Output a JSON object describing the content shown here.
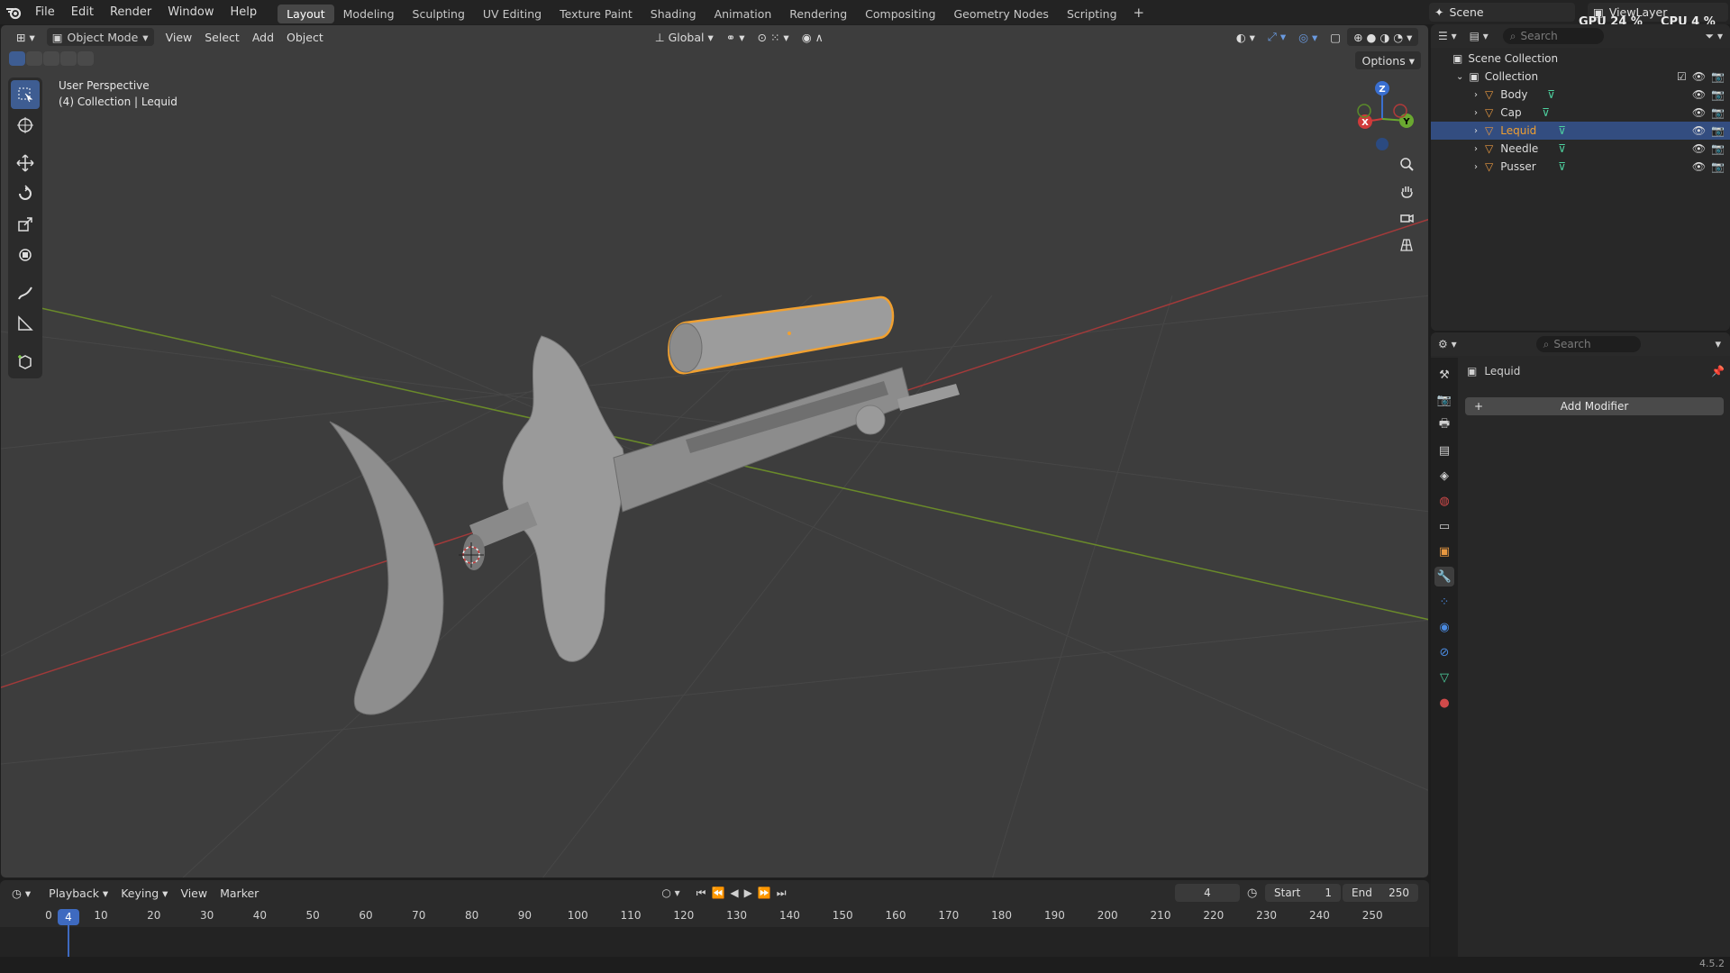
{
  "topbar": {
    "menus": [
      "File",
      "Edit",
      "Render",
      "Window",
      "Help"
    ],
    "workspaces": [
      "Layout",
      "Modeling",
      "Sculpting",
      "UV Editing",
      "Texture Paint",
      "Shading",
      "Animation",
      "Rendering",
      "Compositing",
      "Geometry Nodes",
      "Scripting"
    ],
    "active_workspace": "Layout",
    "add_label": "+",
    "scene": "Scene",
    "view_layer": "ViewLayer",
    "gpu_label": "GPU",
    "gpu_value": "24 %",
    "cpu_label": "CPU",
    "cpu_value": "4 %"
  },
  "viewport": {
    "mode": "Object Mode",
    "menus": [
      "View",
      "Select",
      "Add",
      "Object"
    ],
    "transform_orientation": "Global",
    "options_label": "Options",
    "info_line1": "User Perspective",
    "info_line2": "(4) Collection | Lequid",
    "gizmo": {
      "x": "X",
      "y": "Y",
      "z": "Z"
    }
  },
  "outliner": {
    "search_placeholder": "Search",
    "scene_collection": "Scene Collection",
    "collection": "Collection",
    "objects": [
      "Body",
      "Cap",
      "Lequid",
      "Needle",
      "Pusser"
    ],
    "selected_object": "Lequid"
  },
  "properties": {
    "search_placeholder": "Search",
    "object_name": "Lequid",
    "add_modifier": "Add Modifier"
  },
  "timeline": {
    "menus": [
      "Playback",
      "Keying",
      "View",
      "Marker"
    ],
    "current_frame": "4",
    "start_label": "Start",
    "start_value": "1",
    "end_label": "End",
    "end_value": "250",
    "ruler": [
      "0",
      "10",
      "20",
      "30",
      "40",
      "50",
      "60",
      "70",
      "80",
      "90",
      "100",
      "110",
      "120",
      "130",
      "140",
      "150",
      "160",
      "170",
      "180",
      "190",
      "200",
      "210",
      "220",
      "230",
      "240",
      "250"
    ]
  },
  "status": {
    "version": "4.5.2"
  },
  "colors": {
    "accent": "#3e5d92",
    "selection_outline": "#f0a030",
    "x_axis": "#a23a3a",
    "y_axis": "#6a8a2a"
  }
}
